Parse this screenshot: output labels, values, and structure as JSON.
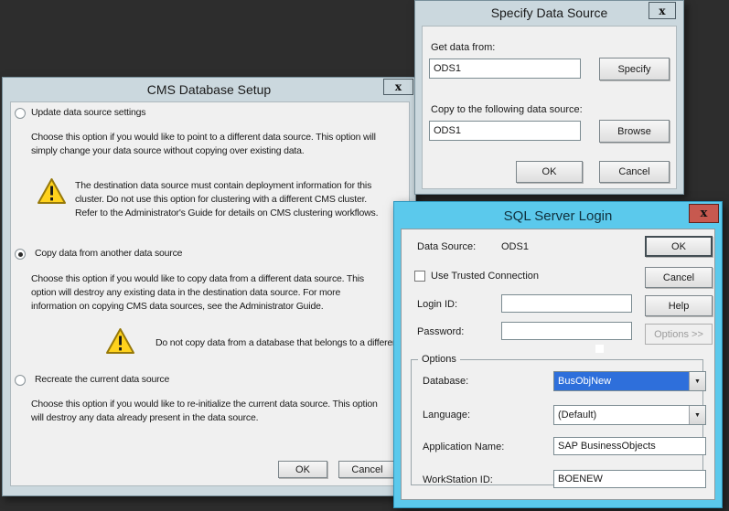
{
  "cms": {
    "title": "CMS Database Setup",
    "close_glyph": "x",
    "option1": {
      "label": "Update data source settings",
      "desc": [
        "Choose this option if you would like to point to a different data source. This option will",
        "simply change your data source without copying over existing data."
      ],
      "warning": [
        "The destination data source must contain deployment information for this",
        "cluster. Do not use this option for clustering with a different CMS cluster.",
        "Refer to the Administrator's Guide for details on CMS clustering workflows."
      ]
    },
    "option2": {
      "label": "Copy data from another data source",
      "selected": true,
      "desc": [
        "Choose this option if you would like to copy data from a different data source. This",
        "option will destroy any existing data in the destination data source. For more",
        "information on copying CMS data sources, see the Administrator Guide."
      ],
      "warning": [
        "Do not copy data from a database that belongs to a different cluster."
      ]
    },
    "option3": {
      "label": "Recreate the current data source",
      "desc": [
        "Choose this option if you would like to re-initialize the current data source. This option",
        "will destroy any data already present in the data source."
      ]
    },
    "ok": "OK",
    "cancel": "Cancel"
  },
  "specify": {
    "title": "Specify Data Source",
    "close_glyph": "x",
    "get_data_label": "Get data from:",
    "get_data_value": "ODS1",
    "specify_btn": "Specify",
    "copy_to_label": "Copy to the following data source:",
    "copy_to_value": "ODS1",
    "browse_btn": "Browse",
    "ok": "OK",
    "cancel": "Cancel"
  },
  "sql": {
    "title": "SQL Server Login",
    "close_glyph": "x",
    "data_source_label": "Data Source:",
    "data_source_value": "ODS1",
    "trusted_checkbox_label": "Use Trusted Connection",
    "login_id_label": "Login ID:",
    "login_id_value": "",
    "password_label": "Password:",
    "password_value": "",
    "ok": "OK",
    "cancel": "Cancel",
    "help": "Help",
    "options_btn": "Options >>",
    "options_group": {
      "label": "Options",
      "database_label": "Database:",
      "database_value": "BusObjNew",
      "language_label": "Language:",
      "language_value": "(Default)",
      "application_name_label": "Application Name:",
      "application_name_value": "SAP BusinessObjects",
      "workstation_id_label": "WorkStation ID:",
      "workstation_id_value": "BOENEW"
    },
    "dropdown_glyph": "▼"
  },
  "colors": {
    "desktop_background": "#2d2d2d",
    "titlebar": "#cbd8de",
    "dialog_body": "#f0f0f0",
    "active_dialog_border": "#5bc9ec",
    "close_button_red": "#c7594f",
    "selected_item_blue": "#2e6fdb",
    "warning_yellow": "#ffd21c"
  }
}
